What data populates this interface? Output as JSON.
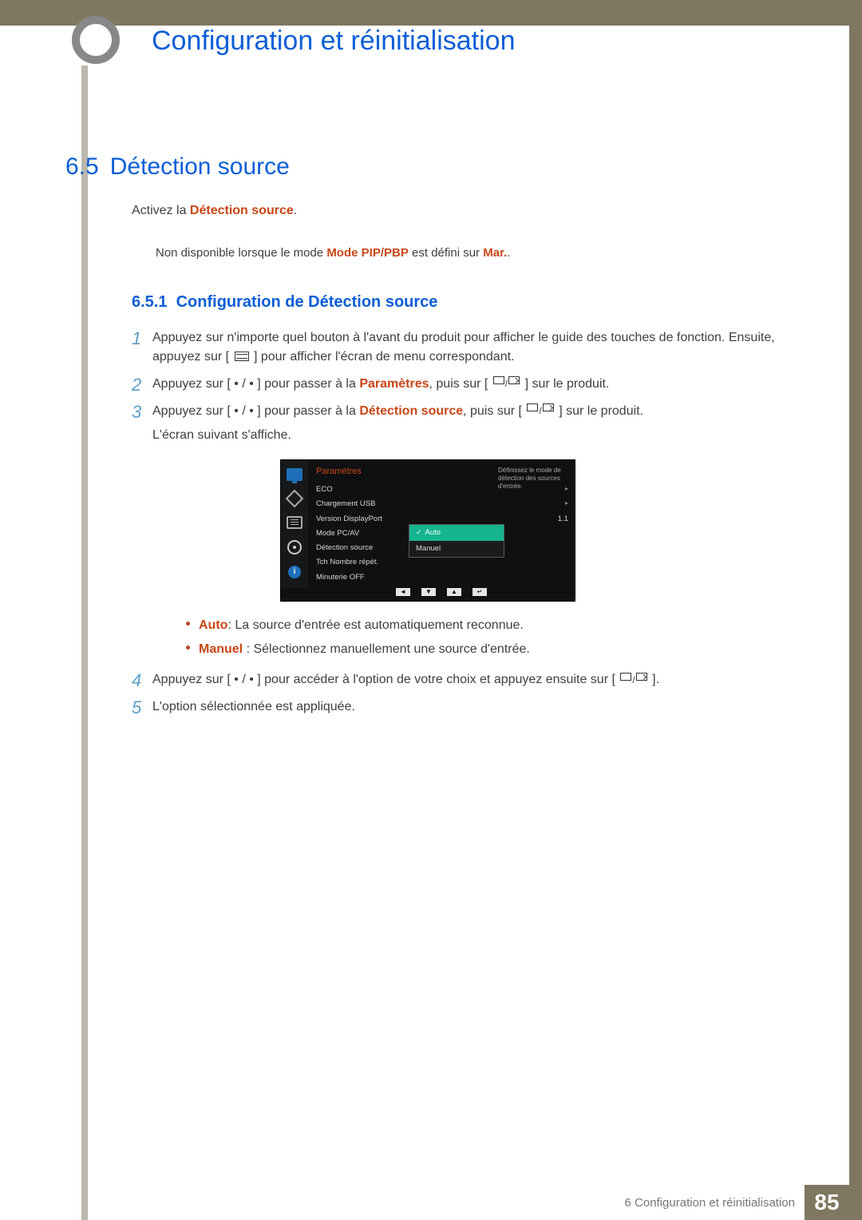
{
  "header": {
    "chapter_title": "Configuration et réinitialisation"
  },
  "section": {
    "number": "6.5",
    "title": "Détection source",
    "activation_prefix": "Activez la ",
    "activation_bold": "Détection source",
    "note_prefix": "Non disponible lorsque le mode ",
    "note_bold1": "Mode PIP/PBP",
    "note_mid": " est défini sur ",
    "note_bold2": "Mar.",
    "note_suffix": "."
  },
  "subsection": {
    "number": "6.5.1",
    "title": "Configuration de Détection source"
  },
  "steps": {
    "s1": "Appuyez sur n'importe quel bouton à l'avant du produit pour afficher le guide des touches de fonction. Ensuite, appuyez sur [",
    "s1b": "] pour afficher l'écran de menu correspondant.",
    "s2a": "Appuyez sur [ • / • ] pour passer à la ",
    "s2bold": "Paramètres",
    "s2b": ", puis sur [",
    "s2c": "] sur le produit.",
    "s3a": "Appuyez sur [ • / • ] pour passer à la ",
    "s3bold": "Détection source",
    "s3b": ", puis sur [",
    "s3c": "] sur le produit.",
    "s3extra": "L'écran suivant s'affiche.",
    "s4a": "Appuyez sur [ • / • ] pour accéder à l'option de votre choix et appuyez ensuite sur [",
    "s4b": "].",
    "s5": "L'option sélectionnée est appliquée."
  },
  "osd": {
    "title": "Paramètres",
    "items": [
      {
        "label": "ECO",
        "val": "▸"
      },
      {
        "label": "Chargement USB",
        "val": "▸"
      },
      {
        "label": "Version DisplayPort",
        "val": "1.1"
      },
      {
        "label": "Mode PC/AV",
        "val": ""
      },
      {
        "label": "Détection source",
        "val": ""
      },
      {
        "label": "Tch Nombre répét.",
        "val": ""
      },
      {
        "label": "Minuterie OFF",
        "val": ""
      }
    ],
    "help": "Définissez le mode de détection des sources d'entrée.",
    "popup": {
      "opt1": "Auto",
      "opt2": "Manuel"
    },
    "nav": [
      "◄",
      "▼",
      "▲",
      "↵"
    ],
    "info_char": "i"
  },
  "bullets": {
    "auto_label": "Auto",
    "auto_text": ": La source d'entrée est automatiquement reconnue.",
    "manuel_label": "Manuel ",
    "manuel_text": ": Sélectionnez manuellement une source d'entrée."
  },
  "footer": {
    "text": "6 Configuration et réinitialisation",
    "page": "85"
  }
}
